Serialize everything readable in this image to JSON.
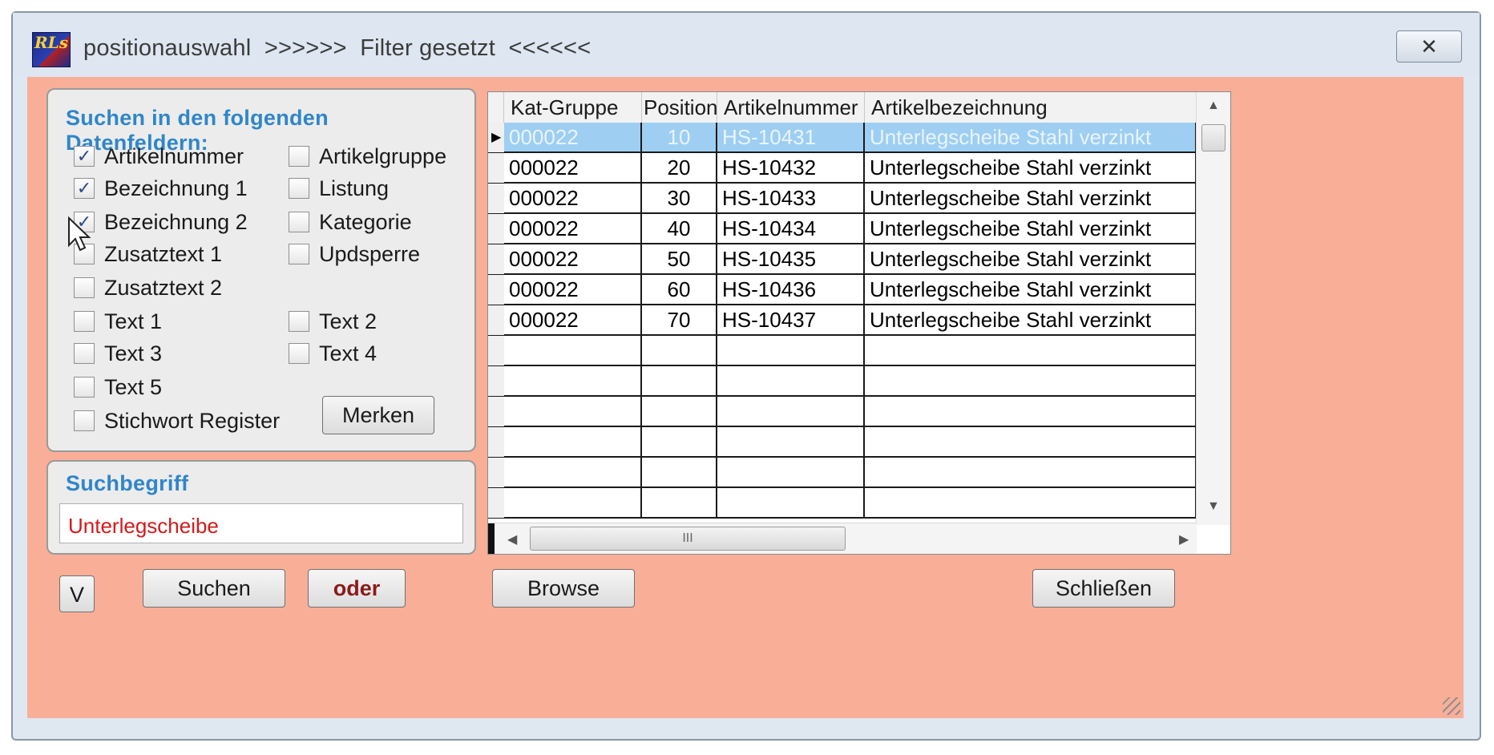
{
  "window": {
    "title": "positionauswahl  >>>>>>  Filter gesetzt  <<<<<<",
    "app_icon_text": "RLs",
    "close_glyph": "✕"
  },
  "colors": {
    "client_bg": "#f9ae98",
    "panel_title": "#2f86c8",
    "search_text": "#d21a1a",
    "oder_text": "#8b1a1a",
    "row_selected": "#9ecff2"
  },
  "search_fields": {
    "title": "Suchen in den folgenden Datenfeldern:",
    "left": [
      {
        "label": "Artikelnummer",
        "checked": true
      },
      {
        "label": "Bezeichnung 1",
        "checked": true
      },
      {
        "label": "Bezeichnung 2",
        "checked": true
      },
      {
        "label": "Zusatztext 1",
        "checked": false
      },
      {
        "label": "Zusatztext 2",
        "checked": false
      },
      {
        "label": "Text 1",
        "checked": false
      },
      {
        "label": "Text 3",
        "checked": false
      },
      {
        "label": "Text 5",
        "checked": false
      },
      {
        "label": "Stichwort Register",
        "checked": false
      }
    ],
    "right": [
      {
        "label": "Artikelgruppe",
        "checked": false
      },
      {
        "label": "Listung",
        "checked": false
      },
      {
        "label": "Kategorie",
        "checked": false
      },
      {
        "label": "Updsperre",
        "checked": false
      },
      {
        "label": "Text 2",
        "checked": false
      },
      {
        "label": "Text 4",
        "checked": false
      }
    ],
    "merken_label": "Merken"
  },
  "suchbegriff": {
    "title": "Suchbegriff",
    "value": "Unterlegscheibe"
  },
  "grid": {
    "columns": [
      "Kat-Gruppe",
      "Position",
      "Artikelnummer",
      "Artikelbezeichnung"
    ],
    "rows": [
      [
        "000022",
        "10",
        "HS-10431",
        "Unterlegscheibe Stahl verzinkt"
      ],
      [
        "000022",
        "20",
        "HS-10432",
        "Unterlegscheibe Stahl verzinkt"
      ],
      [
        "000022",
        "30",
        "HS-10433",
        "Unterlegscheibe Stahl verzinkt"
      ],
      [
        "000022",
        "40",
        "HS-10434",
        "Unterlegscheibe Stahl verzinkt"
      ],
      [
        "000022",
        "50",
        "HS-10435",
        "Unterlegscheibe Stahl verzinkt"
      ],
      [
        "000022",
        "60",
        "HS-10436",
        "Unterlegscheibe Stahl verzinkt"
      ],
      [
        "000022",
        "70",
        "HS-10437",
        "Unterlegscheibe Stahl verzinkt"
      ]
    ],
    "empty_rows": 6,
    "selected_row": 0,
    "hscroll_thumb_glyph": "III"
  },
  "buttons": {
    "v_label": "V",
    "suchen_label": "Suchen",
    "oder_label": "oder",
    "browse_label": "Browse",
    "schliessen_label": "Schließen"
  }
}
